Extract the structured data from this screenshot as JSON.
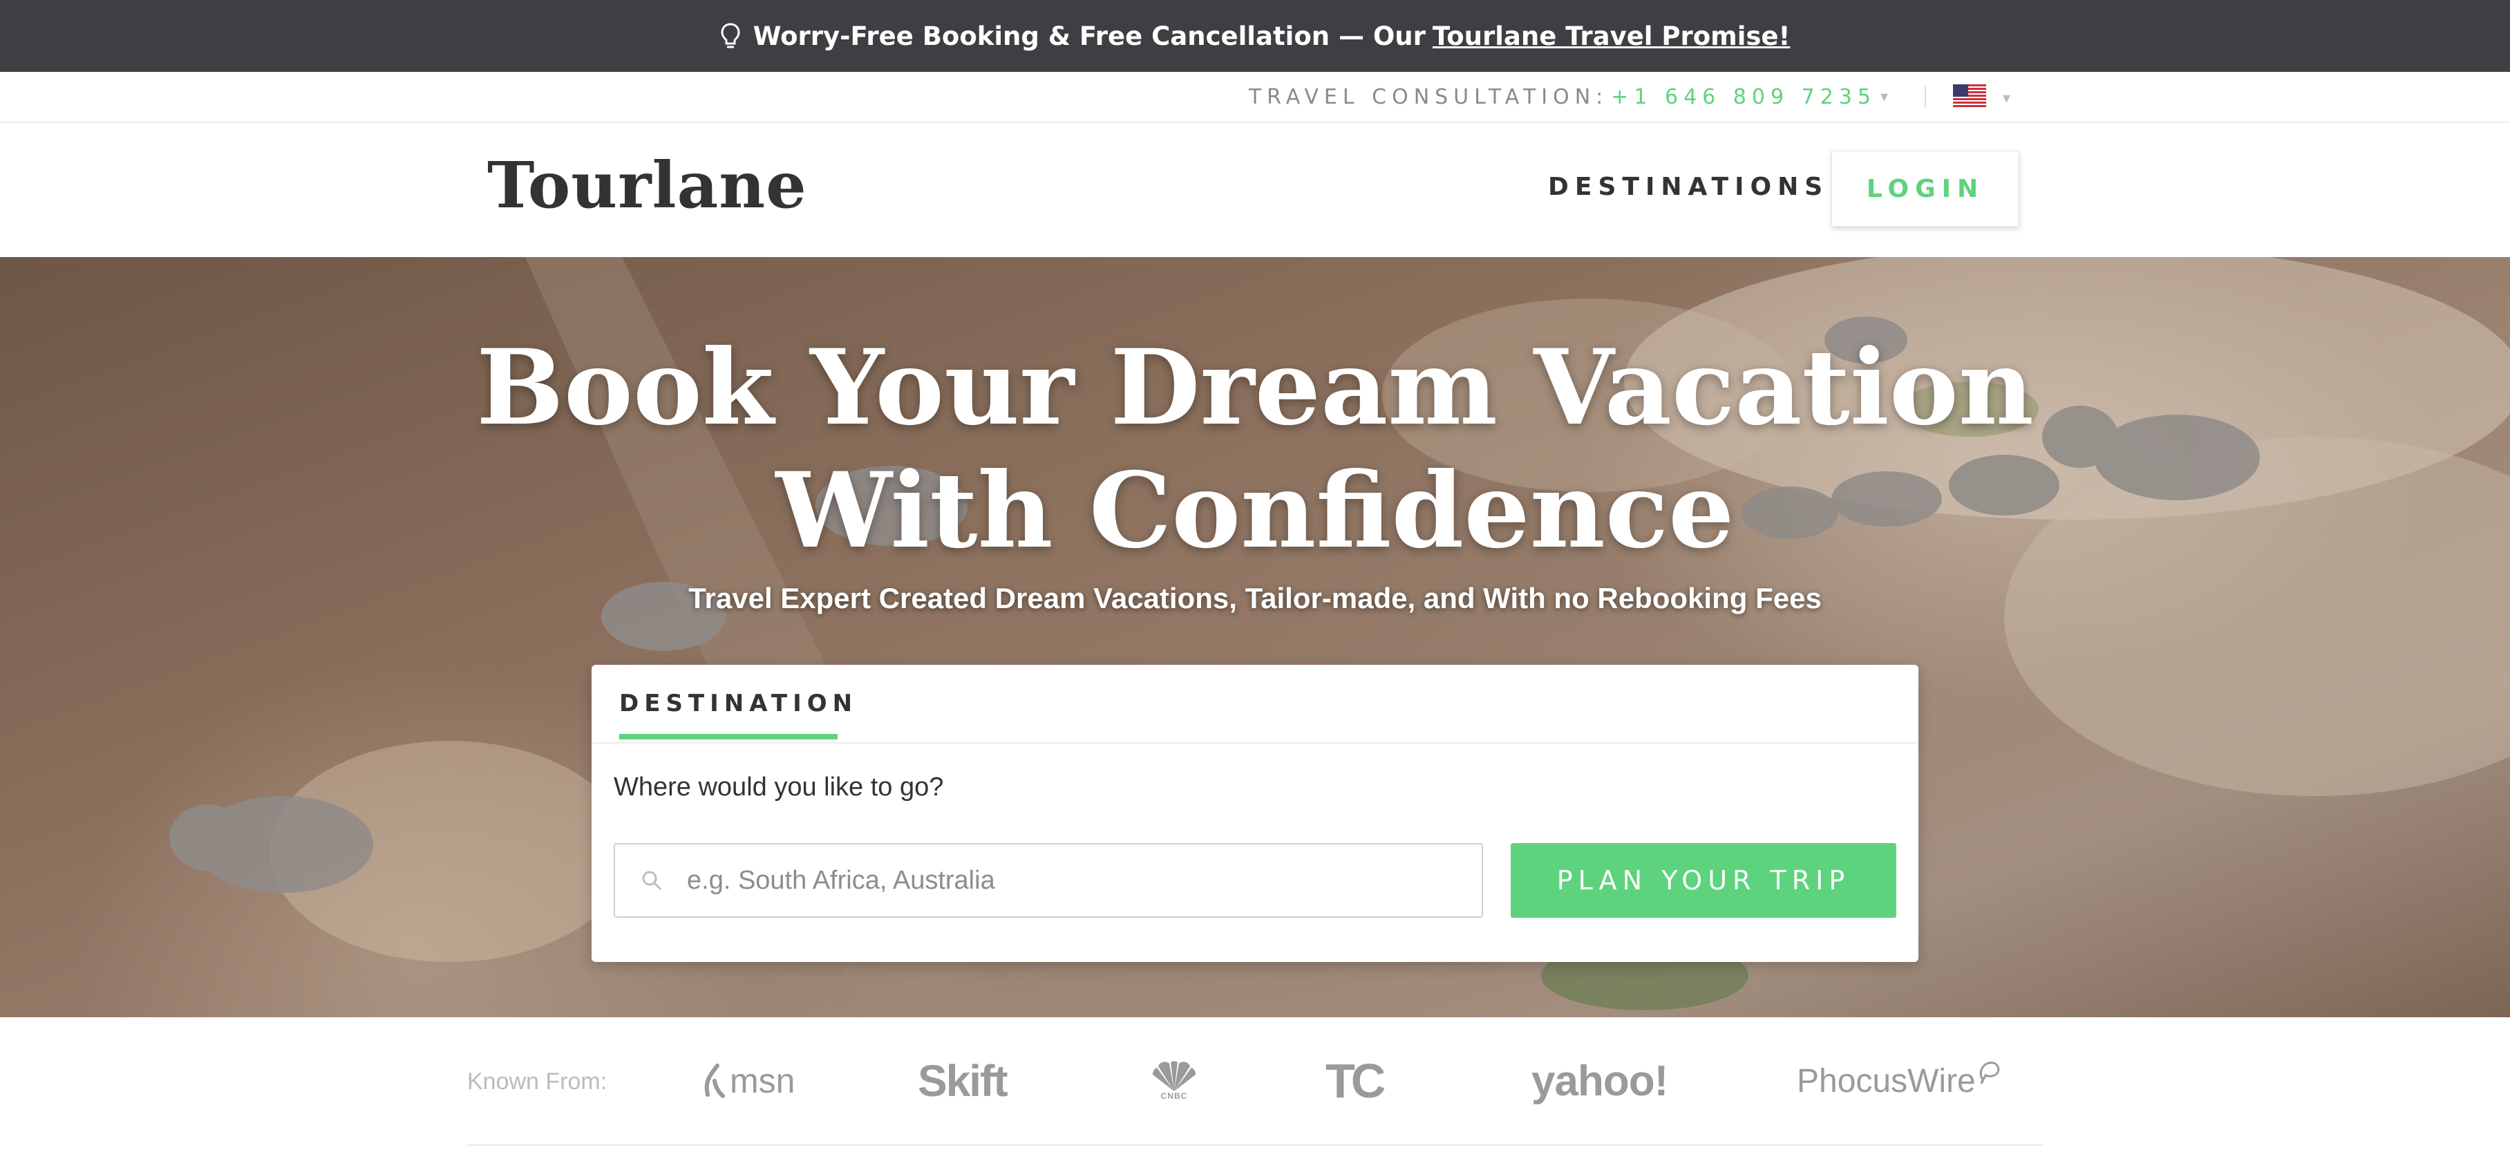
{
  "promo": {
    "text": "Worry-Free Booking & Free Cancellation — Our",
    "link": "Tourlane Travel Promise!",
    "icon": "lightbulb-icon"
  },
  "utility": {
    "consultation_label": "TRAVEL CONSULTATION:",
    "phone": "+1 646 809 7235",
    "phone_caret": "▾",
    "flag_icon": "us-flag-icon",
    "flag_caret": "▾"
  },
  "header": {
    "logo": "Tourlane",
    "nav_destinations": "DESTINATIONS",
    "login": "LOGIN"
  },
  "hero": {
    "title_line1": "Book Your Dream Vacation",
    "title_line2": "With Confidence",
    "subtitle": "Travel Expert Created Dream Vacations, Tailor-made, and With no Rebooking Fees"
  },
  "search": {
    "tab_label": "DESTINATION",
    "question": "Where would you like to go?",
    "placeholder": "e.g. South Africa, Australia",
    "value": "",
    "button": "PLAN YOUR TRIP"
  },
  "press": {
    "label": "Known From:",
    "logos": [
      "msn",
      "Skift",
      "CNBC",
      "TC",
      "yahoo!",
      "PhocusWire"
    ]
  },
  "colors": {
    "accent": "#5dd37d",
    "promo_bg": "#3d3f42",
    "text": "#333333"
  }
}
